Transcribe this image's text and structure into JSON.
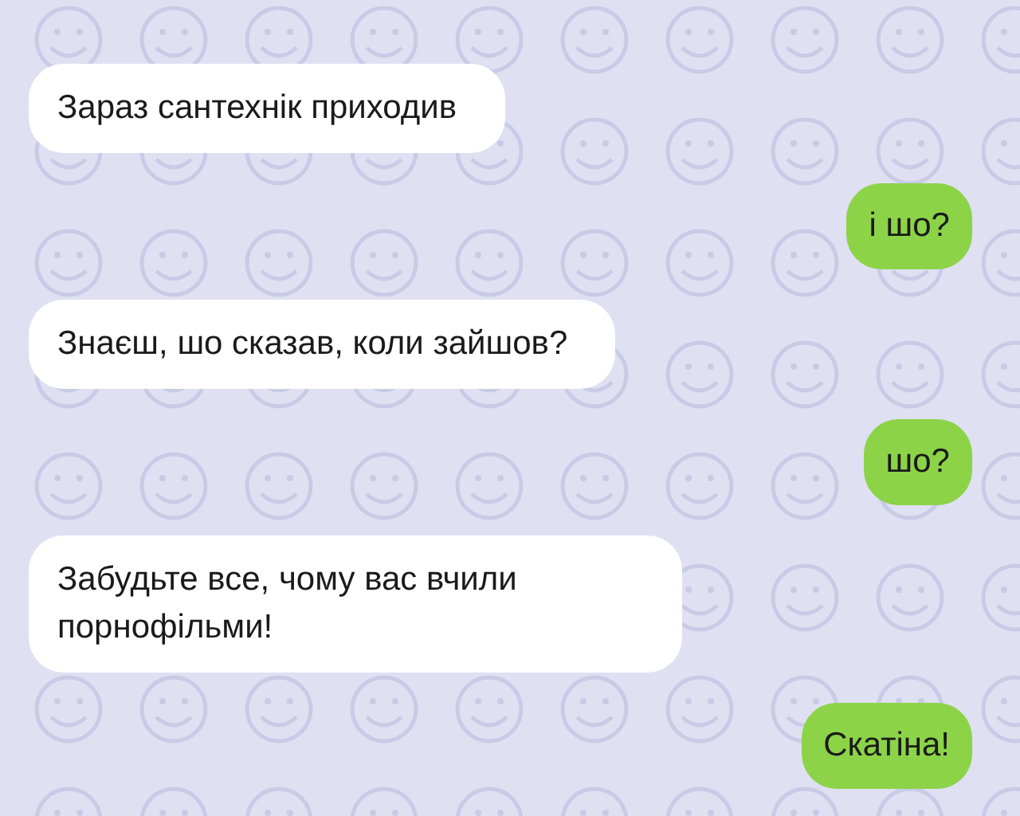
{
  "messages": [
    {
      "kind": "received",
      "text": "Зараз сантехнік приходив"
    },
    {
      "kind": "sent",
      "text": "і шо?"
    },
    {
      "kind": "received",
      "text": "Знаєш, шо сказав, коли зайшов?"
    },
    {
      "kind": "sent",
      "text": "шо?"
    },
    {
      "kind": "received",
      "text": "Забудьте все, чому вас вчили порнофільми!"
    },
    {
      "kind": "sent",
      "text": "Скатіна!"
    }
  ]
}
